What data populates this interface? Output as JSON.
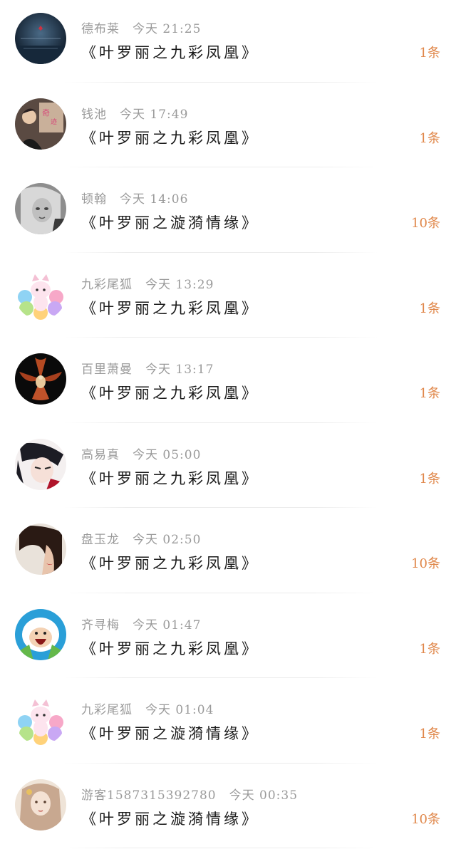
{
  "items": [
    {
      "name": "德布莱",
      "time": "今天 21:25",
      "title": "《叶罗丽之九彩凤凰》",
      "count": "1条",
      "avatar": "dark-blue-scene"
    },
    {
      "name": "钱池",
      "time": "今天 17:49",
      "title": "《叶罗丽之九彩凤凰》",
      "count": "1条",
      "avatar": "boy-with-poster"
    },
    {
      "name": "顿翰",
      "time": "今天 14:06",
      "title": "《叶罗丽之漩漪情缘》",
      "count": "10条",
      "avatar": "bw-blonde-girl"
    },
    {
      "name": "九彩尾狐",
      "time": "今天 13:29",
      "title": "《叶罗丽之九彩凤凰》",
      "count": "1条",
      "avatar": "rainbow-fox"
    },
    {
      "name": "百里萧曼",
      "time": "今天 13:17",
      "title": "《叶罗丽之九彩凤凰》",
      "count": "1条",
      "avatar": "orchid-flower"
    },
    {
      "name": "高易真",
      "time": "今天 05:00",
      "title": "《叶罗丽之九彩凤凰》",
      "count": "1条",
      "avatar": "anime-dark-hair"
    },
    {
      "name": "盘玉龙",
      "time": "今天 02:50",
      "title": "《叶罗丽之九彩凤凰》",
      "count": "10条",
      "avatar": "red-lips-girl"
    },
    {
      "name": "齐寻梅",
      "time": "今天 01:47",
      "title": "《叶罗丽之九彩凤凰》",
      "count": "1条",
      "avatar": "cartoon-shouting"
    },
    {
      "name": "九彩尾狐",
      "time": "今天 01:04",
      "title": "《叶罗丽之漩漪情缘》",
      "count": "1条",
      "avatar": "rainbow-fox"
    },
    {
      "name": "游客1587315392780",
      "time": "今天 00:35",
      "title": "《叶罗丽之漩漪情缘》",
      "count": "10条",
      "avatar": "vintage-girl"
    }
  ]
}
